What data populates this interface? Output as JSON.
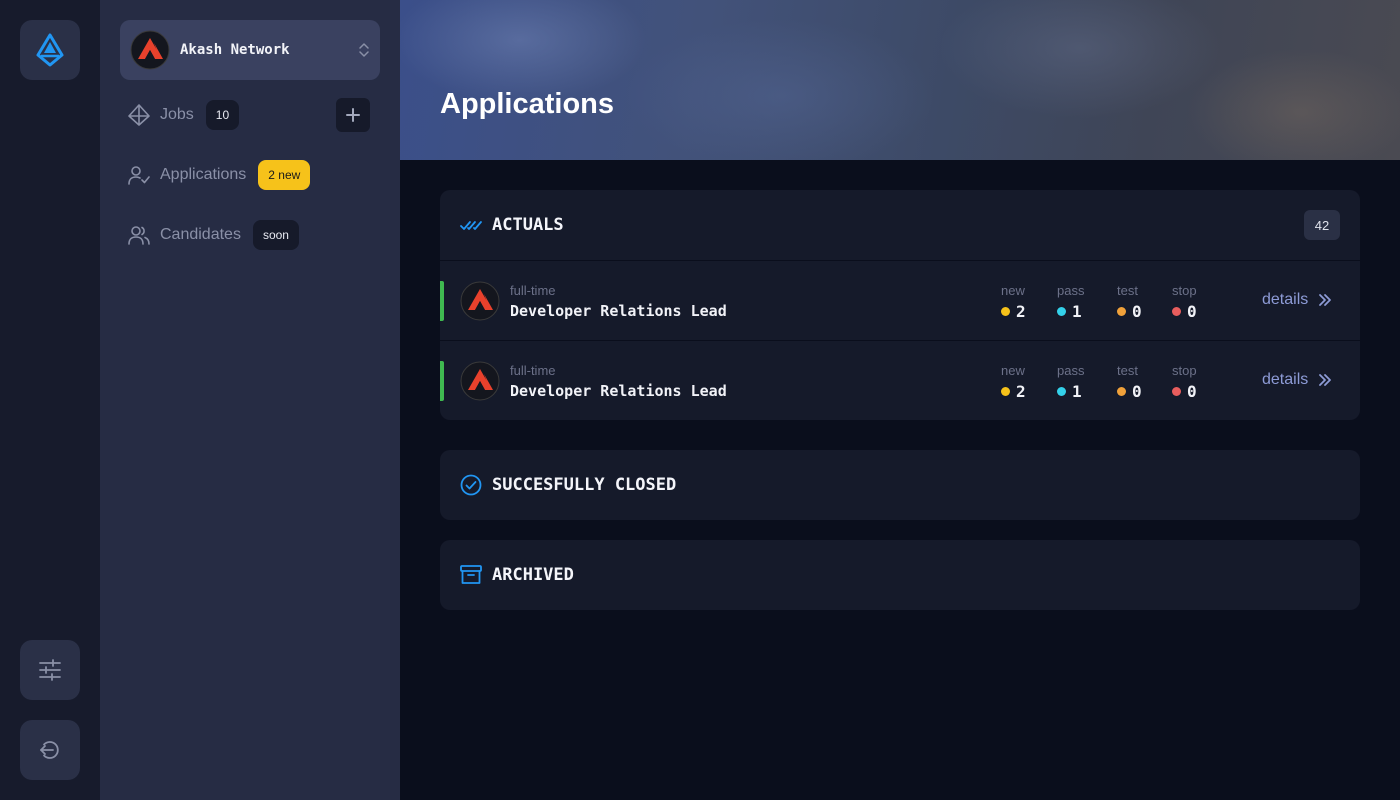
{
  "colors": {
    "accent_green": "#3fb950",
    "new": "#f6c21a",
    "pass": "#33d1ea",
    "test": "#f0a13a",
    "stop": "#e85d5d",
    "brand_blue": "#2196f3",
    "akash_red": "#e8412c"
  },
  "rail": {
    "logo_icon": "app-logo-icon",
    "settings_icon": "sliders-icon",
    "logout_icon": "logout-icon"
  },
  "sidebar": {
    "org": {
      "name": "Akash Network",
      "icon": "chevron-updown-icon"
    },
    "items": [
      {
        "label": "Jobs",
        "badge": "10",
        "icon": "jobs-icon"
      },
      {
        "label": "Applications",
        "badge": "2 new",
        "icon": "user-check-icon"
      },
      {
        "label": "Candidates",
        "badge": "soon",
        "icon": "users-icon"
      }
    ],
    "add_label": "+"
  },
  "header": {
    "title": "Applications"
  },
  "sections": {
    "actuals": {
      "title": "ACTUALS",
      "count": "42",
      "rows": [
        {
          "type": "full-time",
          "title": "Developer Relations Lead",
          "stats": [
            {
              "label": "new",
              "value": "2"
            },
            {
              "label": "pass",
              "value": "1"
            },
            {
              "label": "test",
              "value": "0"
            },
            {
              "label": "stop",
              "value": "0"
            }
          ],
          "details": "details"
        },
        {
          "type": "full-time",
          "title": "Developer Relations Lead",
          "stats": [
            {
              "label": "new",
              "value": "2"
            },
            {
              "label": "pass",
              "value": "1"
            },
            {
              "label": "test",
              "value": "0"
            },
            {
              "label": "stop",
              "value": "0"
            }
          ],
          "details": "details"
        }
      ]
    },
    "closed": {
      "title": "SUCCESFULLY CLOSED"
    },
    "archived": {
      "title": "ARCHIVED"
    }
  }
}
